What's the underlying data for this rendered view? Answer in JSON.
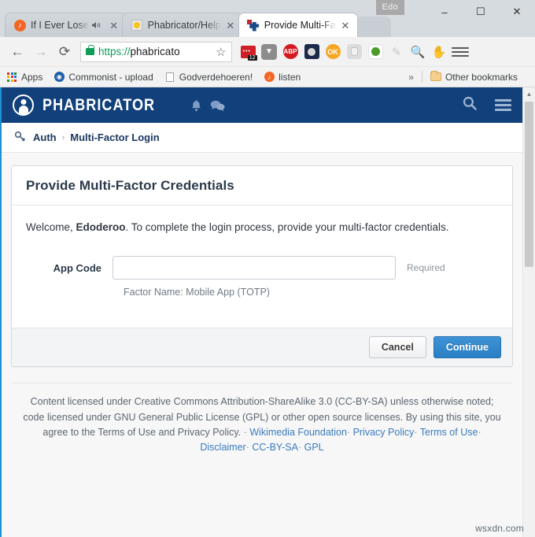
{
  "browser": {
    "edo_badge": "Edo",
    "window_controls": {
      "minimize": "–",
      "maximize": "☐",
      "close": "✕"
    },
    "tabs": [
      {
        "title": "If I Ever Lose ",
        "favicon": "music-note-icon",
        "audio": true,
        "active": false
      },
      {
        "title": "Phabricator/Help",
        "favicon": "phabricator-help-icon",
        "audio": false,
        "active": false
      },
      {
        "title": "Provide Multi-Fa",
        "favicon": "phabricator-icon",
        "audio": false,
        "active": true
      }
    ],
    "nav": {
      "back": "←",
      "forward": "→",
      "reload": "⟳",
      "url_scheme": "https://",
      "url_host": "phabricato",
      "lock": "lock-icon",
      "star": "☆"
    },
    "extensions": [
      "rss-subscribe-icon",
      "downthemall-icon",
      "adblock-plus-icon",
      "night-mode-icon",
      "ok-icon",
      "shield-icon",
      "globe-translate-icon",
      "paint-icon",
      "zoom-search-icon",
      "hand-icon"
    ],
    "ext_badge_count": "12",
    "menu": "chrome-menu-icon",
    "bookmarks": [
      {
        "label": "Apps",
        "icon": "apps-grid-icon"
      },
      {
        "label": "Commonist - upload",
        "icon": "commonist-icon"
      },
      {
        "label": "Godverdehoeren!",
        "icon": "document-icon"
      },
      {
        "label": "listen",
        "icon": "listen-icon"
      }
    ],
    "bookmarks_overflow": "»",
    "other_bookmarks": {
      "label": "Other bookmarks",
      "icon": "folder-icon"
    }
  },
  "site": {
    "header": {
      "wordmark": "PHABRICATOR",
      "logo": "phabricator-wikimedia-logo",
      "bell": "bell-icon",
      "chat": "chat-icon",
      "search": "search-icon",
      "menu": "menu-icon"
    },
    "breadcrumb": {
      "icon": "key-icon",
      "root": "Auth",
      "separator": "›",
      "current": "Multi-Factor Login"
    },
    "panel": {
      "title": "Provide Multi-Factor Credentials",
      "welcome_prefix": "Welcome, ",
      "welcome_user": "Edoderoo",
      "welcome_suffix": ". To complete the login process, provide your multi-factor credentials.",
      "field": {
        "label": "App Code",
        "value": "",
        "placeholder": "",
        "required_note": "Required",
        "caption": "Factor Name: Mobile App (TOTP)"
      },
      "buttons": {
        "cancel": "Cancel",
        "continue": "Continue"
      }
    },
    "footer": {
      "line1": "Content licensed under Creative Commons Attribution-ShareAlike 3.0 (CC-BY-SA) unless otherwise",
      "line2": "noted; code licensed under GNU General Public License (GPL) or other open source licenses. By using",
      "line3": "this site, you agree to the Terms of Use and Privacy Policy. ",
      "links": [
        "Wikimedia Foundation",
        "Privacy Policy",
        "Terms of Use",
        "Disclaimer",
        "CC-BY-SA",
        "GPL"
      ],
      "dot": "·"
    }
  },
  "watermark": "wsxdn.com",
  "colors": {
    "phab_header": "#12407a",
    "primary_button": "#2a7fc4",
    "link": "#3a7bbd",
    "page_bg": "#f7f7f7",
    "lock_green": "#0f9d58"
  }
}
